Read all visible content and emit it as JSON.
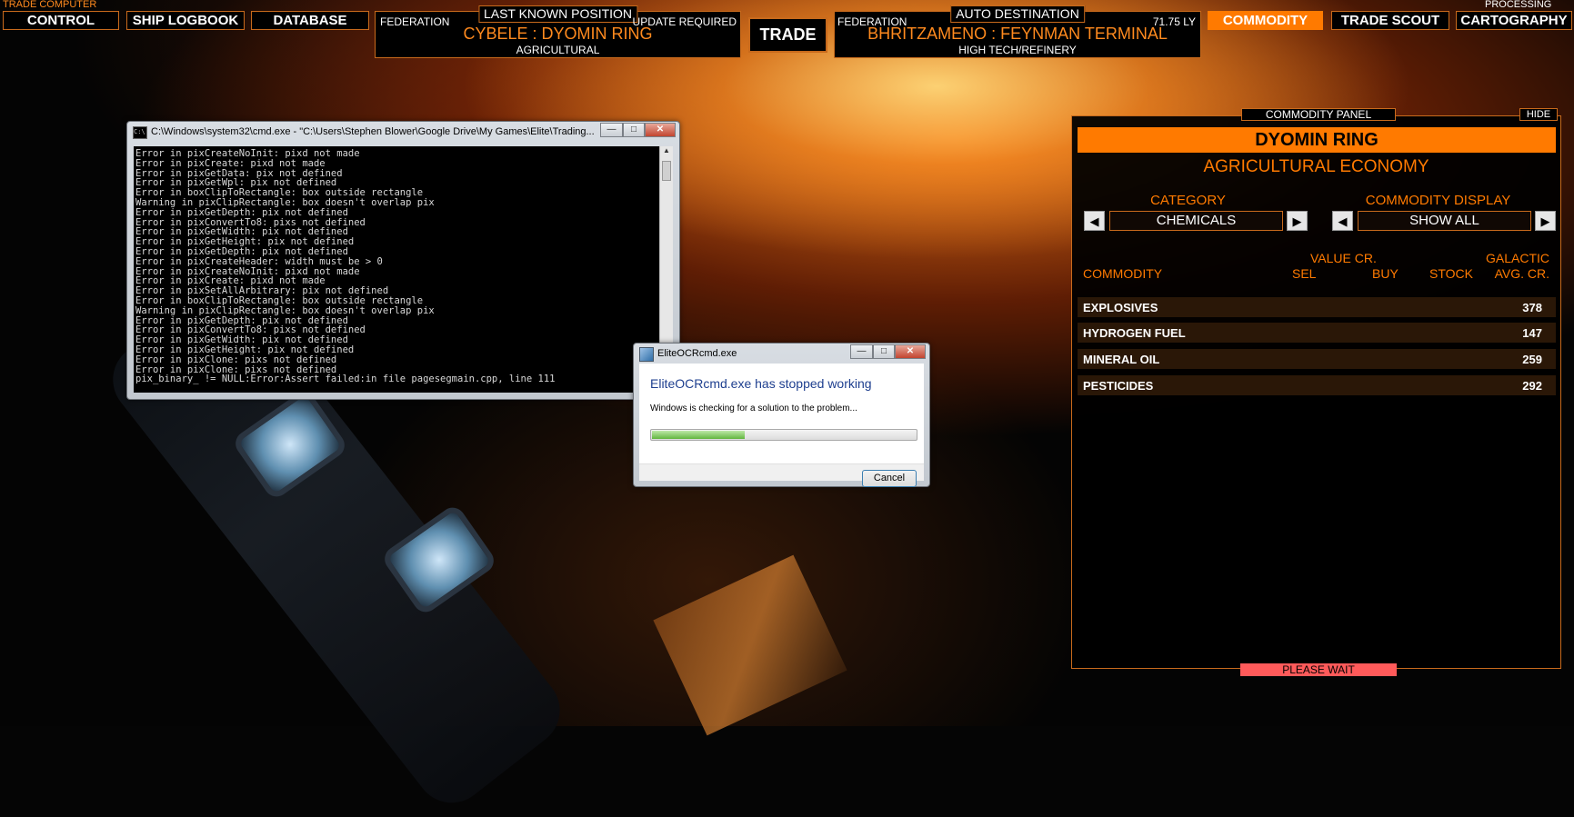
{
  "corner_labels": {
    "left": "TRADE COMPUTER",
    "right": "PROCESSING"
  },
  "nav": {
    "control": "CONTROL",
    "ship_logbook": "SHIP LOGBOOK",
    "database": "DATABASE",
    "trade": "TRADE",
    "commodity": "COMMODITY",
    "trade_scout": "TRADE SCOUT",
    "cartography": "CARTOGRAPHY"
  },
  "last_known_position": {
    "tag": "LAST KNOWN POSITION",
    "faction": "FEDERATION",
    "status": "UPDATE REQUIRED",
    "location": "CYBELE : DYOMIN RING",
    "economy": "AGRICULTURAL"
  },
  "auto_destination": {
    "tag": "AUTO DESTINATION",
    "faction": "FEDERATION",
    "distance": "71.75 LY",
    "location": "BHRITZAMENO : FEYNMAN TERMINAL",
    "economy": "HIGH TECH/REFINERY"
  },
  "commodity_panel": {
    "tag": "COMMODITY PANEL",
    "hide": "HIDE",
    "station": "DYOMIN RING",
    "economy": "AGRICULTURAL ECONOMY",
    "category_label": "CATEGORY",
    "category_value": "CHEMICALS",
    "display_label": "COMMODITY DISPLAY",
    "display_value": "SHOW ALL",
    "headers": {
      "commodity": "COMMODITY",
      "value_cr": "VALUE CR.",
      "sel": "SEL",
      "buy": "BUY",
      "stock": "STOCK",
      "galactic": "GALACTIC",
      "avg_cr": "AVG. CR."
    },
    "rows": [
      {
        "name": "EXPLOSIVES",
        "avg": "378"
      },
      {
        "name": "HYDROGEN FUEL",
        "avg": "147"
      },
      {
        "name": "MINERAL OIL",
        "avg": "259"
      },
      {
        "name": "PESTICIDES",
        "avg": "292"
      }
    ],
    "status": "PLEASE WAIT"
  },
  "cmd_window": {
    "title": "C:\\Windows\\system32\\cmd.exe - \"C:\\Users\\Stephen Blower\\Google Drive\\My Games\\Elite\\Trading...",
    "icon": "cmd-icon",
    "output": "Error in pixCreateNoInit: pixd not made\nError in pixCreate: pixd not made\nError in pixGetData: pix not defined\nError in pixGetWpl: pix not defined\nError in boxClipToRectangle: box outside rectangle\nWarning in pixClipRectangle: box doesn't overlap pix\nError in pixGetDepth: pix not defined\nError in pixConvertTo8: pixs not defined\nError in pixGetWidth: pix not defined\nError in pixGetHeight: pix not defined\nError in pixGetDepth: pix not defined\nError in pixCreateHeader: width must be > 0\nError in pixCreateNoInit: pixd not made\nError in pixCreate: pixd not made\nError in pixSetAllArbitrary: pix not defined\nError in boxClipToRectangle: box outside rectangle\nWarning in pixClipRectangle: box doesn't overlap pix\nError in pixGetDepth: pix not defined\nError in pixConvertTo8: pixs not defined\nError in pixGetWidth: pix not defined\nError in pixGetHeight: pix not defined\nError in pixClone: pixs not defined\nError in pixClone: pixs not defined\npix_binary_ != NULL:Error:Assert failed:in file pagesegmain.cpp, line 111"
  },
  "error_dialog": {
    "title": "EliteOCRcmd.exe",
    "heading": "EliteOCRcmd.exe has stopped working",
    "message": "Windows is checking for a solution to the problem...",
    "progress": 0.35,
    "cancel": "Cancel"
  }
}
